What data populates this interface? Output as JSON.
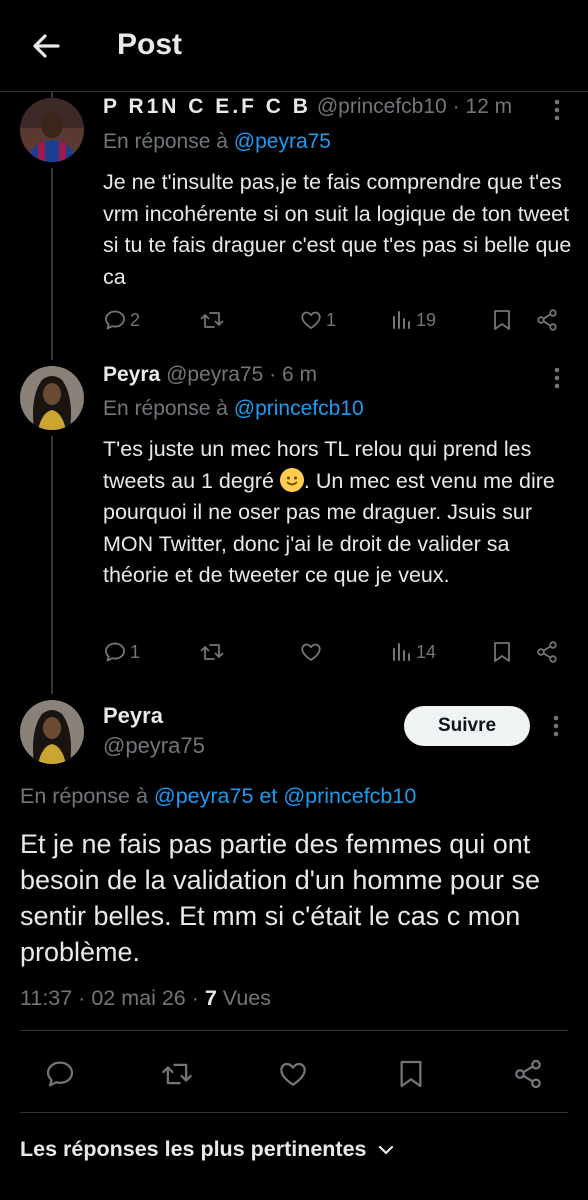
{
  "header": {
    "title": "Post",
    "back_icon": "arrow-left-icon"
  },
  "replies": [
    {
      "display_name": "P R1N C E.F C B",
      "handle": "@princefcb10",
      "time": "· 12 m",
      "replying_label": "En réponse à",
      "replying_to": "@peyra75",
      "text": "Je ne t'insulte pas,je te fais comprendre que t'es vrm incohérente si on suit la logique de ton tweet si tu te fais draguer c'est que t'es pas si belle que ca",
      "stats": {
        "replies": "2",
        "retweets": "",
        "likes": "1",
        "views": "19"
      }
    },
    {
      "display_name": "Peyra",
      "handle": "@peyra75",
      "time": "· 6 m",
      "replying_label": "En réponse à",
      "replying_to": "@princefcb10",
      "text_before_emoji": "T'es juste un mec hors TL relou qui prend les tweets au 1 degré ",
      "emoji": "🙂",
      "text_after_emoji": ". Un mec est venu me dire pourquoi il ne oser pas me draguer. Jsuis sur MON Twitter, donc j'ai le droit de valider sa théorie et de tweeter ce que je veux.",
      "stats": {
        "replies": "1",
        "retweets": "",
        "likes": "",
        "views": "14"
      }
    }
  ],
  "main_post": {
    "display_name": "Peyra",
    "handle": "@peyra75",
    "follow_label": "Suivre",
    "replying_label": "En réponse à",
    "replying_to_1": "@peyra75",
    "replying_and": "et",
    "replying_to_2": "@princefcb10",
    "text": "Et je ne fais pas partie des femmes qui ont besoin de la validation d'un homme pour se sentir belles.  Et mm si c'était le cas c mon problème.",
    "timestamp": "11:37 · 02 mai 26 · ",
    "views_count": "7",
    "views_label": "Vues"
  },
  "relevant_label": "Les réponses les plus pertinentes",
  "colors": {
    "background": "#000000",
    "text": "#e7e9ea",
    "muted": "#71767b",
    "link": "#1d9bf0",
    "border": "#2f3336"
  }
}
